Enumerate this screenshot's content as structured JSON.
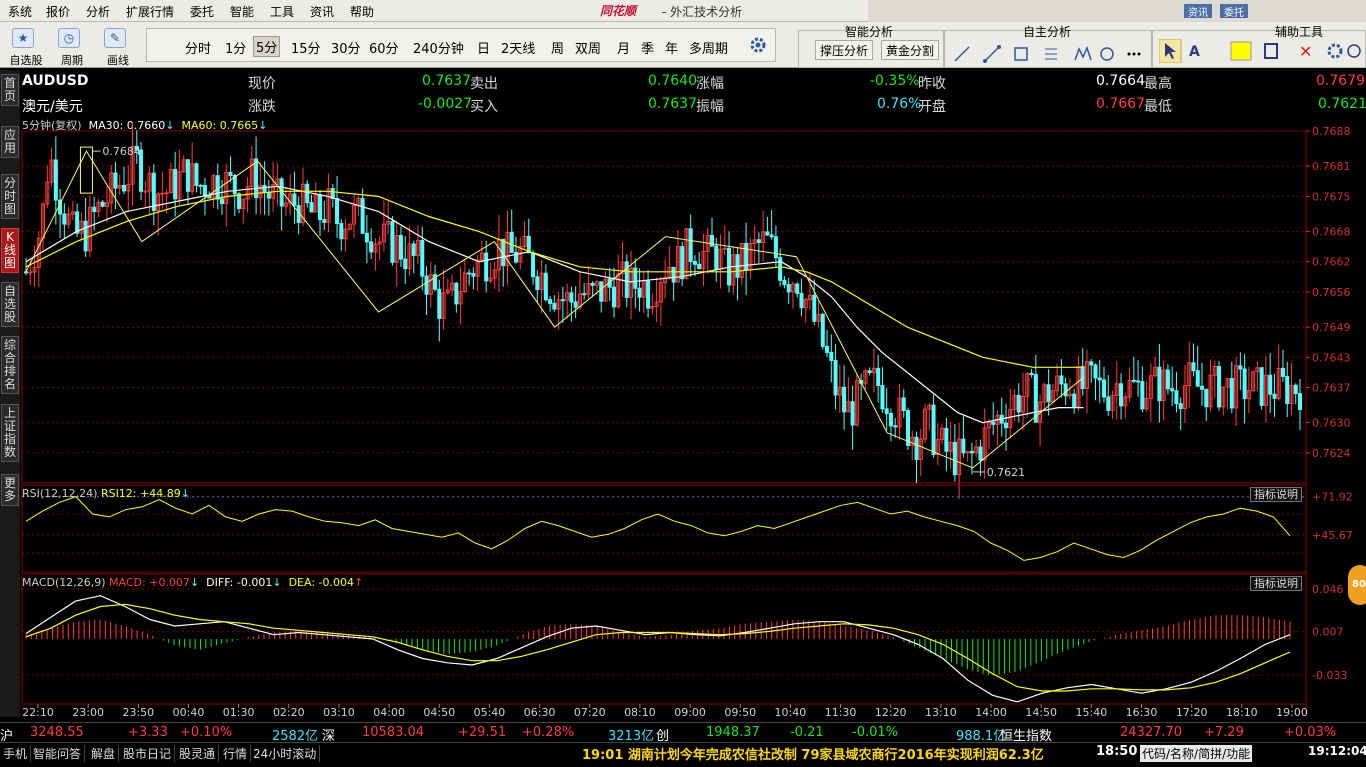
{
  "menu": {
    "items": [
      "系统",
      "报价",
      "分析",
      "扩展行情",
      "委托",
      "智能",
      "工具",
      "资讯",
      "帮助"
    ],
    "brand": "同花顺",
    "title": "- 外汇技术分析",
    "right_buttons": [
      "资讯",
      "委托"
    ]
  },
  "toolbar": {
    "left_buttons": [
      "自选股",
      "周期",
      "画线"
    ],
    "periods": [
      "分时",
      "1分",
      "5分",
      "15分",
      "30分",
      "60分",
      "240分钟",
      "日",
      "2天线",
      "周",
      "双周",
      "月",
      "季",
      "年",
      "多周期"
    ],
    "active_period": "5分",
    "smart_analysis": {
      "title": "智能分析",
      "buttons": [
        "撑压分析",
        "黄金分割"
      ]
    },
    "self_analysis": {
      "title": "自主分析"
    },
    "aux_tools": {
      "title": "辅助工具"
    }
  },
  "left_tabs": [
    "首页",
    "应用",
    "分时图",
    "K线图",
    "自选股",
    "综合排名",
    "上证指数",
    "更多"
  ],
  "active_left_tab": "K线图",
  "quote": {
    "symbol": "AUDUSD",
    "name": "澳元/美元",
    "fields": [
      {
        "label": "现价",
        "value": "0.7637",
        "color": "green"
      },
      {
        "label": "卖出",
        "value": "0.7640",
        "color": "green"
      },
      {
        "label": "涨幅",
        "value": "-0.35%",
        "color": "green"
      },
      {
        "label": "昨收",
        "value": "0.7664",
        "color": "white"
      },
      {
        "label": "最高",
        "value": "0.7679",
        "color": "red"
      },
      {
        "label": "涨跌",
        "value": "-0.0027",
        "color": "green"
      },
      {
        "label": "买入",
        "value": "0.7637",
        "color": "green"
      },
      {
        "label": "振幅",
        "value": "0.76%",
        "color": "cyan"
      },
      {
        "label": "开盘",
        "value": "0.7667",
        "color": "red"
      },
      {
        "label": "最低",
        "value": "0.7621",
        "color": "green"
      }
    ]
  },
  "ma_legend": {
    "period": "5分钟(复权)",
    "ma30": "MA30: 0.7660",
    "ma60": "MA60: 0.7665"
  },
  "rsi_legend": {
    "label": "RSI(12,12,24)",
    "value": "RSI12: +44.89"
  },
  "macd_legend": {
    "label": "MACD(12,26,9)",
    "macd": "MACD: +0.007",
    "diff": "DIFF: -0.001",
    "dea": "DEA: -0.004"
  },
  "explain_label": "指标说明",
  "badge": "80",
  "index_bar": [
    {
      "text": "沪",
      "color": "white"
    },
    {
      "text": "3248.55",
      "color": "red"
    },
    {
      "text": "+3.33",
      "color": "red"
    },
    {
      "text": "+0.10%",
      "color": "red"
    },
    {
      "text": "2582亿",
      "color": "cyan"
    },
    {
      "text": "深",
      "color": "white"
    },
    {
      "text": "10583.04",
      "color": "red"
    },
    {
      "text": "+29.51",
      "color": "red"
    },
    {
      "text": "+0.28%",
      "color": "red"
    },
    {
      "text": "3213亿",
      "color": "cyan"
    },
    {
      "text": "创",
      "color": "white"
    },
    {
      "text": "1948.37",
      "color": "green"
    },
    {
      "text": "-0.21",
      "color": "green"
    },
    {
      "text": "-0.01%",
      "color": "green"
    },
    {
      "text": "988.1亿",
      "color": "cyan"
    },
    {
      "text": "恒生指数",
      "color": "white"
    },
    {
      "text": "24327.70",
      "color": "red"
    },
    {
      "text": "+7.29",
      "color": "red"
    },
    {
      "text": "+0.03%",
      "color": "red"
    }
  ],
  "status_bar": {
    "items": [
      "手机",
      "智能问答",
      "解盘",
      "股市日记",
      "股灵通",
      "行情",
      "24小时滚动"
    ],
    "news": "19:01 湖南计划今年完成农信社改制 79家县域农商行2016年实现利润62.3亿",
    "news_time": "18:50",
    "search_hint": "代码/名称/简拼/功能",
    "clock": "19:12:04"
  },
  "colors": {
    "up": "#ff3c3c",
    "down": "#54ffff",
    "ma30": "#ffffff",
    "ma60": "#ffff00",
    "grid": "#7a0000",
    "rsi": "#ffff00",
    "diff": "#ffffff",
    "dea": "#ffff00",
    "macd_pos": "#ff3c3c",
    "macd_neg": "#15e815"
  },
  "chart_data": {
    "type": "candlestick",
    "title": "AUDUSD 5分钟(复权)",
    "price_axis": {
      "ticks": [
        "0.7688",
        "0.7681",
        "0.7675",
        "0.7668",
        "0.7662",
        "0.7656",
        "0.7649",
        "0.7643",
        "0.7637",
        "0.7630",
        "0.7624"
      ],
      "ylim": [
        0.7618,
        0.7688
      ]
    },
    "time_axis": [
      "22:10",
      "23:00",
      "23:50",
      "00:40",
      "01:30",
      "02:20",
      "03:10",
      "04:00",
      "04:50",
      "05:40",
      "06:30",
      "07:20",
      "08:10",
      "09:00",
      "09:50",
      "10:40",
      "11:30",
      "12:20",
      "13:10",
      "14:00",
      "14:50",
      "15:40",
      "16:30",
      "17:20",
      "18:10",
      "19:00"
    ],
    "annotations": [
      {
        "text": "0.7684",
        "kind": "high"
      },
      {
        "text": "0.7621",
        "kind": "low"
      }
    ],
    "price_path": {
      "x": [
        0,
        3,
        6,
        8,
        9,
        11,
        14,
        19,
        24,
        28,
        33,
        36,
        40,
        44,
        48,
        52,
        56,
        60,
        64,
        68,
        73,
        78,
        82,
        86,
        90,
        95,
        100,
        104,
        108,
        112,
        116,
        120,
        124,
        128,
        132,
        136,
        140,
        144,
        148,
        152,
        156,
        160,
        164,
        168,
        172,
        176,
        180,
        184,
        188,
        192,
        196,
        200,
        204,
        208,
        212,
        216,
        220,
        224,
        228,
        232,
        236,
        240,
        244,
        248,
        252,
        255,
        258,
        262,
        266,
        270,
        274,
        278,
        282,
        286,
        290,
        294,
        298,
        302,
        306,
        310,
        314,
        318,
        322,
        326,
        330,
        334,
        338,
        342,
        346,
        350,
        354,
        358,
        362,
        366,
        370,
        374,
        378,
        382,
        386,
        390,
        394,
        398,
        402,
        406,
        410,
        414,
        418,
        420,
        422,
        426,
        430,
        434,
        438,
        442,
        446,
        450,
        454,
        458,
        462,
        466,
        470,
        474,
        478,
        482,
        486,
        490,
        494,
        498,
        502,
        506
      ],
      "y": [
        0.766,
        0.7664,
        0.7669,
        0.7677,
        0.7684,
        0.768,
        0.7674,
        0.7667,
        0.7668,
        0.7672,
        0.7675,
        0.7677,
        0.7679,
        0.7682,
        0.7678,
        0.7676,
        0.7676,
        0.7678,
        0.768,
        0.7677,
        0.7678,
        0.7678,
        0.7677,
        0.7676,
        0.7679,
        0.7676,
        0.7674,
        0.7673,
        0.7674,
        0.7672,
        0.7671,
        0.7673,
        0.767,
        0.7671,
        0.7671,
        0.7669,
        0.7666,
        0.7666,
        0.7665,
        0.7663,
        0.7662,
        0.7658,
        0.7654,
        0.7653,
        0.7657,
        0.766,
        0.7662,
        0.7663,
        0.7665,
        0.7663,
        0.7664,
        0.7662,
        0.766,
        0.7657,
        0.7655,
        0.7654,
        0.7656,
        0.7655,
        0.7656,
        0.7657,
        0.7658,
        0.7657,
        0.7658,
        0.7656,
        0.766,
        0.7662,
        0.7661,
        0.7664,
        0.7665,
        0.7663,
        0.7664,
        0.766,
        0.7661,
        0.7662,
        0.7665,
        0.7666,
        0.7663,
        0.7659,
        0.7659,
        0.7654,
        0.7649,
        0.7643,
        0.7636,
        0.7632,
        0.7634,
        0.7637,
        0.7638,
        0.7635,
        0.7632,
        0.7629,
        0.7627,
        0.763,
        0.7626,
        0.7624,
        0.7623,
        0.7622,
        0.7625,
        0.7628,
        0.7631,
        0.7633,
        0.7635,
        0.7636,
        0.7634,
        0.7636,
        0.7637,
        0.7638,
        0.7637,
        0.7637,
        0.7638,
        0.7637,
        0.7636,
        0.7638,
        0.7637,
        0.7637,
        0.7637,
        0.7638,
        0.7637,
        0.7637,
        0.7638,
        0.7637,
        0.7637,
        0.7637,
        0.7637,
        0.7637,
        0.7637,
        0.7637,
        0.7637,
        0.7637,
        0.7637,
        0.7637
      ]
    },
    "ma30": {
      "x": [
        0,
        20,
        40,
        60,
        80,
        100,
        120,
        140,
        160,
        180,
        200,
        220,
        240,
        260,
        280,
        300,
        310,
        320,
        330,
        340,
        350,
        360,
        370,
        380,
        390,
        400,
        410,
        420
      ],
      "y": [
        0.7662,
        0.7668,
        0.7672,
        0.7674,
        0.7676,
        0.7677,
        0.7675,
        0.7672,
        0.7666,
        0.7662,
        0.7664,
        0.766,
        0.7658,
        0.7659,
        0.7661,
        0.7662,
        0.7659,
        0.7655,
        0.7649,
        0.7644,
        0.764,
        0.7636,
        0.7632,
        0.763,
        0.7631,
        0.7632,
        0.7633,
        0.7633
      ]
    },
    "ma60": {
      "x": [
        0,
        20,
        40,
        60,
        80,
        100,
        120,
        140,
        160,
        180,
        200,
        220,
        240,
        260,
        280,
        300,
        310,
        320,
        330,
        340,
        350,
        360,
        370,
        380,
        390,
        400,
        410,
        420
      ],
      "y": [
        0.7661,
        0.7666,
        0.767,
        0.7673,
        0.7675,
        0.7676,
        0.7676,
        0.7675,
        0.7671,
        0.7668,
        0.7664,
        0.7661,
        0.766,
        0.766,
        0.766,
        0.7661,
        0.766,
        0.7658,
        0.7655,
        0.7652,
        0.7649,
        0.7647,
        0.7645,
        0.7643,
        0.7642,
        0.7641,
        0.7641,
        0.7641
      ]
    },
    "zigzag": {
      "x": [
        0,
        24,
        46,
        92,
        140,
        186,
        210,
        254,
        306,
        342,
        376,
        420
      ],
      "y": [
        0.766,
        0.7684,
        0.7666,
        0.7682,
        0.7652,
        0.7666,
        0.7649,
        0.7667,
        0.7663,
        0.7628,
        0.7621,
        0.7639
      ]
    },
    "rsi": {
      "axis_ticks": [
        "+71.92",
        "+45.67"
      ],
      "ylim": [
        20,
        80
      ],
      "values": [
        55,
        62,
        68,
        72,
        60,
        58,
        63,
        65,
        70,
        64,
        60,
        66,
        58,
        55,
        60,
        63,
        62,
        58,
        55,
        54,
        52,
        56,
        50,
        48,
        46,
        44,
        47,
        40,
        36,
        42,
        50,
        55,
        52,
        48,
        44,
        46,
        50,
        56,
        60,
        55,
        52,
        47,
        45,
        48,
        52,
        50,
        54,
        58,
        62,
        66,
        68,
        64,
        60,
        62,
        58,
        55,
        52,
        48,
        40,
        35,
        28,
        30,
        34,
        40,
        36,
        32,
        30,
        35,
        42,
        48,
        54,
        58,
        60,
        64,
        62,
        58,
        45
      ]
    },
    "macd": {
      "axis_ticks": [
        "0.046",
        "0.007",
        "-0.033"
      ],
      "ylim": [
        -0.06,
        0.06
      ],
      "diff": [
        0.005,
        0.02,
        0.035,
        0.04,
        0.03,
        0.018,
        0.012,
        0.014,
        0.016,
        0.01,
        0.004,
        0.006,
        0.004,
        0.002,
        0.0,
        -0.01,
        -0.018,
        -0.022,
        -0.024,
        -0.018,
        -0.008,
        0.002,
        0.01,
        0.012,
        0.008,
        0.004,
        0.006,
        0.004,
        0.003,
        0.006,
        0.01,
        0.014,
        0.016,
        0.016,
        0.01,
        0.004,
        -0.005,
        -0.018,
        -0.038,
        -0.052,
        -0.058,
        -0.05,
        -0.045,
        -0.042,
        -0.046,
        -0.05,
        -0.046,
        -0.04,
        -0.03,
        -0.018,
        -0.005,
        0.004
      ],
      "dea": [
        0.002,
        0.01,
        0.022,
        0.03,
        0.032,
        0.028,
        0.022,
        0.018,
        0.016,
        0.014,
        0.01,
        0.008,
        0.006,
        0.004,
        0.002,
        -0.003,
        -0.01,
        -0.016,
        -0.02,
        -0.02,
        -0.016,
        -0.01,
        -0.003,
        0.004,
        0.006,
        0.006,
        0.006,
        0.005,
        0.004,
        0.005,
        0.007,
        0.01,
        0.012,
        0.014,
        0.013,
        0.01,
        0.004,
        -0.005,
        -0.018,
        -0.032,
        -0.044,
        -0.048,
        -0.048,
        -0.046,
        -0.046,
        -0.047,
        -0.047,
        -0.045,
        -0.04,
        -0.032,
        -0.022,
        -0.012
      ],
      "bars": [
        0.004,
        0.01,
        0.016,
        0.018,
        0.012,
        0.004,
        -0.006,
        -0.01,
        -0.004,
        0.002,
        0.006,
        0.008,
        0.006,
        0.004,
        0.002,
        -0.004,
        -0.01,
        -0.014,
        -0.012,
        -0.006,
        0.004,
        0.012,
        0.014,
        0.012,
        0.006,
        0.002,
        0.004,
        0.008,
        0.01,
        0.014,
        0.016,
        0.018,
        0.016,
        0.012,
        0.008,
        0.002,
        -0.008,
        -0.018,
        -0.028,
        -0.034,
        -0.03,
        -0.02,
        -0.01,
        -0.002,
        0.004,
        0.008,
        0.012,
        0.018,
        0.022,
        0.022,
        0.02,
        0.016
      ]
    }
  }
}
